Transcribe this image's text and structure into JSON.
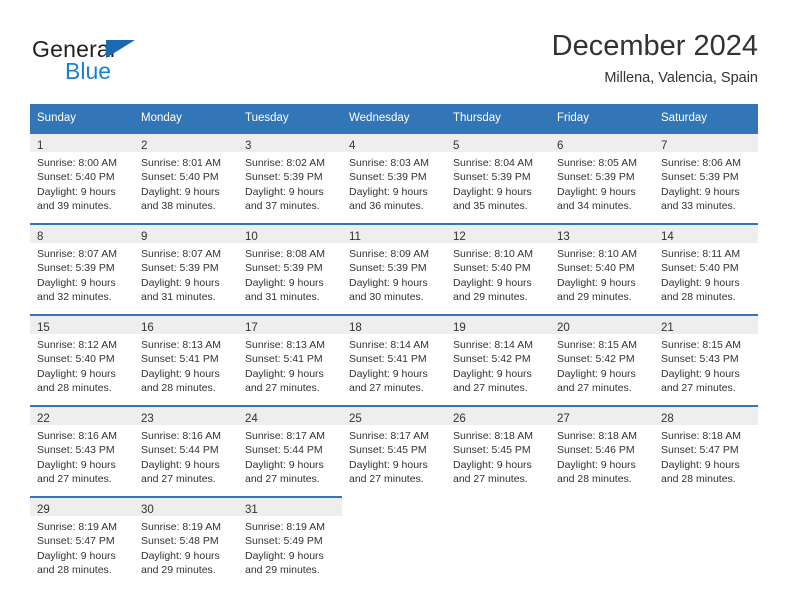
{
  "brand": {
    "name_part1": "General",
    "name_part2": "Blue",
    "icon": "triangle-logo-icon"
  },
  "header": {
    "month_title": "December 2024",
    "location": "Millena, Valencia, Spain"
  },
  "calendar": {
    "weekday_headers": [
      "Sunday",
      "Monday",
      "Tuesday",
      "Wednesday",
      "Thursday",
      "Friday",
      "Saturday"
    ],
    "accent_color": "#3276b8",
    "daynum_background": "#eeeeee",
    "weeks": [
      [
        {
          "day": "1",
          "sunrise": "Sunrise: 8:00 AM",
          "sunset": "Sunset: 5:40 PM",
          "daylight_line1": "Daylight: 9 hours",
          "daylight_line2": "and 39 minutes."
        },
        {
          "day": "2",
          "sunrise": "Sunrise: 8:01 AM",
          "sunset": "Sunset: 5:40 PM",
          "daylight_line1": "Daylight: 9 hours",
          "daylight_line2": "and 38 minutes."
        },
        {
          "day": "3",
          "sunrise": "Sunrise: 8:02 AM",
          "sunset": "Sunset: 5:39 PM",
          "daylight_line1": "Daylight: 9 hours",
          "daylight_line2": "and 37 minutes."
        },
        {
          "day": "4",
          "sunrise": "Sunrise: 8:03 AM",
          "sunset": "Sunset: 5:39 PM",
          "daylight_line1": "Daylight: 9 hours",
          "daylight_line2": "and 36 minutes."
        },
        {
          "day": "5",
          "sunrise": "Sunrise: 8:04 AM",
          "sunset": "Sunset: 5:39 PM",
          "daylight_line1": "Daylight: 9 hours",
          "daylight_line2": "and 35 minutes."
        },
        {
          "day": "6",
          "sunrise": "Sunrise: 8:05 AM",
          "sunset": "Sunset: 5:39 PM",
          "daylight_line1": "Daylight: 9 hours",
          "daylight_line2": "and 34 minutes."
        },
        {
          "day": "7",
          "sunrise": "Sunrise: 8:06 AM",
          "sunset": "Sunset: 5:39 PM",
          "daylight_line1": "Daylight: 9 hours",
          "daylight_line2": "and 33 minutes."
        }
      ],
      [
        {
          "day": "8",
          "sunrise": "Sunrise: 8:07 AM",
          "sunset": "Sunset: 5:39 PM",
          "daylight_line1": "Daylight: 9 hours",
          "daylight_line2": "and 32 minutes."
        },
        {
          "day": "9",
          "sunrise": "Sunrise: 8:07 AM",
          "sunset": "Sunset: 5:39 PM",
          "daylight_line1": "Daylight: 9 hours",
          "daylight_line2": "and 31 minutes."
        },
        {
          "day": "10",
          "sunrise": "Sunrise: 8:08 AM",
          "sunset": "Sunset: 5:39 PM",
          "daylight_line1": "Daylight: 9 hours",
          "daylight_line2": "and 31 minutes."
        },
        {
          "day": "11",
          "sunrise": "Sunrise: 8:09 AM",
          "sunset": "Sunset: 5:39 PM",
          "daylight_line1": "Daylight: 9 hours",
          "daylight_line2": "and 30 minutes."
        },
        {
          "day": "12",
          "sunrise": "Sunrise: 8:10 AM",
          "sunset": "Sunset: 5:40 PM",
          "daylight_line1": "Daylight: 9 hours",
          "daylight_line2": "and 29 minutes."
        },
        {
          "day": "13",
          "sunrise": "Sunrise: 8:10 AM",
          "sunset": "Sunset: 5:40 PM",
          "daylight_line1": "Daylight: 9 hours",
          "daylight_line2": "and 29 minutes."
        },
        {
          "day": "14",
          "sunrise": "Sunrise: 8:11 AM",
          "sunset": "Sunset: 5:40 PM",
          "daylight_line1": "Daylight: 9 hours",
          "daylight_line2": "and 28 minutes."
        }
      ],
      [
        {
          "day": "15",
          "sunrise": "Sunrise: 8:12 AM",
          "sunset": "Sunset: 5:40 PM",
          "daylight_line1": "Daylight: 9 hours",
          "daylight_line2": "and 28 minutes."
        },
        {
          "day": "16",
          "sunrise": "Sunrise: 8:13 AM",
          "sunset": "Sunset: 5:41 PM",
          "daylight_line1": "Daylight: 9 hours",
          "daylight_line2": "and 28 minutes."
        },
        {
          "day": "17",
          "sunrise": "Sunrise: 8:13 AM",
          "sunset": "Sunset: 5:41 PM",
          "daylight_line1": "Daylight: 9 hours",
          "daylight_line2": "and 27 minutes."
        },
        {
          "day": "18",
          "sunrise": "Sunrise: 8:14 AM",
          "sunset": "Sunset: 5:41 PM",
          "daylight_line1": "Daylight: 9 hours",
          "daylight_line2": "and 27 minutes."
        },
        {
          "day": "19",
          "sunrise": "Sunrise: 8:14 AM",
          "sunset": "Sunset: 5:42 PM",
          "daylight_line1": "Daylight: 9 hours",
          "daylight_line2": "and 27 minutes."
        },
        {
          "day": "20",
          "sunrise": "Sunrise: 8:15 AM",
          "sunset": "Sunset: 5:42 PM",
          "daylight_line1": "Daylight: 9 hours",
          "daylight_line2": "and 27 minutes."
        },
        {
          "day": "21",
          "sunrise": "Sunrise: 8:15 AM",
          "sunset": "Sunset: 5:43 PM",
          "daylight_line1": "Daylight: 9 hours",
          "daylight_line2": "and 27 minutes."
        }
      ],
      [
        {
          "day": "22",
          "sunrise": "Sunrise: 8:16 AM",
          "sunset": "Sunset: 5:43 PM",
          "daylight_line1": "Daylight: 9 hours",
          "daylight_line2": "and 27 minutes."
        },
        {
          "day": "23",
          "sunrise": "Sunrise: 8:16 AM",
          "sunset": "Sunset: 5:44 PM",
          "daylight_line1": "Daylight: 9 hours",
          "daylight_line2": "and 27 minutes."
        },
        {
          "day": "24",
          "sunrise": "Sunrise: 8:17 AM",
          "sunset": "Sunset: 5:44 PM",
          "daylight_line1": "Daylight: 9 hours",
          "daylight_line2": "and 27 minutes."
        },
        {
          "day": "25",
          "sunrise": "Sunrise: 8:17 AM",
          "sunset": "Sunset: 5:45 PM",
          "daylight_line1": "Daylight: 9 hours",
          "daylight_line2": "and 27 minutes."
        },
        {
          "day": "26",
          "sunrise": "Sunrise: 8:18 AM",
          "sunset": "Sunset: 5:45 PM",
          "daylight_line1": "Daylight: 9 hours",
          "daylight_line2": "and 27 minutes."
        },
        {
          "day": "27",
          "sunrise": "Sunrise: 8:18 AM",
          "sunset": "Sunset: 5:46 PM",
          "daylight_line1": "Daylight: 9 hours",
          "daylight_line2": "and 28 minutes."
        },
        {
          "day": "28",
          "sunrise": "Sunrise: 8:18 AM",
          "sunset": "Sunset: 5:47 PM",
          "daylight_line1": "Daylight: 9 hours",
          "daylight_line2": "and 28 minutes."
        }
      ],
      [
        {
          "day": "29",
          "sunrise": "Sunrise: 8:19 AM",
          "sunset": "Sunset: 5:47 PM",
          "daylight_line1": "Daylight: 9 hours",
          "daylight_line2": "and 28 minutes."
        },
        {
          "day": "30",
          "sunrise": "Sunrise: 8:19 AM",
          "sunset": "Sunset: 5:48 PM",
          "daylight_line1": "Daylight: 9 hours",
          "daylight_line2": "and 29 minutes."
        },
        {
          "day": "31",
          "sunrise": "Sunrise: 8:19 AM",
          "sunset": "Sunset: 5:49 PM",
          "daylight_line1": "Daylight: 9 hours",
          "daylight_line2": "and 29 minutes."
        },
        {
          "day": "",
          "sunrise": "",
          "sunset": "",
          "daylight_line1": "",
          "daylight_line2": ""
        },
        {
          "day": "",
          "sunrise": "",
          "sunset": "",
          "daylight_line1": "",
          "daylight_line2": ""
        },
        {
          "day": "",
          "sunrise": "",
          "sunset": "",
          "daylight_line1": "",
          "daylight_line2": ""
        },
        {
          "day": "",
          "sunrise": "",
          "sunset": "",
          "daylight_line1": "",
          "daylight_line2": ""
        }
      ]
    ]
  }
}
